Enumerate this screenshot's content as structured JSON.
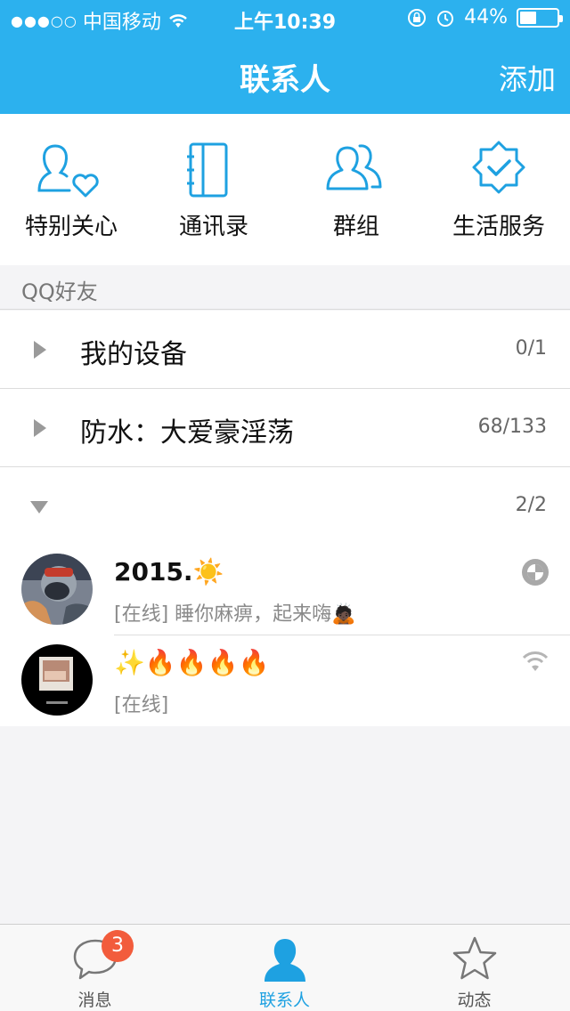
{
  "status_bar": {
    "signal_dots": "●●●○○",
    "carrier": "中国移动",
    "time": "上午10:39",
    "battery_text": "44%",
    "battery_level": 0.44
  },
  "nav": {
    "title": "联系人",
    "add_label": "添加"
  },
  "quick_access": [
    {
      "label": "特别关心",
      "icon": "special-care-icon"
    },
    {
      "label": "通讯录",
      "icon": "address-book-icon"
    },
    {
      "label": "群组",
      "icon": "groups-icon"
    },
    {
      "label": "生活服务",
      "icon": "life-service-icon"
    }
  ],
  "section_header": "QQ好友",
  "groups": [
    {
      "name": "我的设备",
      "count": "0/1",
      "expanded": false
    },
    {
      "name": "防水：大爱豪淫荡",
      "count": "68/133",
      "expanded": false
    },
    {
      "name": "",
      "count": "2/2",
      "expanded": true
    }
  ],
  "friends": [
    {
      "name": "2015.☀️",
      "status": "[在线] 睡你麻痹，起来嗨🙇🏿",
      "device_icon": "mobile-qq-icon"
    },
    {
      "name": "✨🔥🔥🔥🔥",
      "status": "[在线]",
      "device_icon": "wifi-icon"
    }
  ],
  "tabbar": [
    {
      "label": "消息",
      "badge": "3",
      "icon": "message-icon",
      "active": false
    },
    {
      "label": "联系人",
      "badge": "",
      "icon": "contacts-icon",
      "active": true
    },
    {
      "label": "动态",
      "badge": "",
      "icon": "star-icon",
      "active": false
    }
  ],
  "colors": {
    "accent": "#2cb1ee",
    "badge": "#f25c3c",
    "active_tab": "#1ea1e1"
  }
}
